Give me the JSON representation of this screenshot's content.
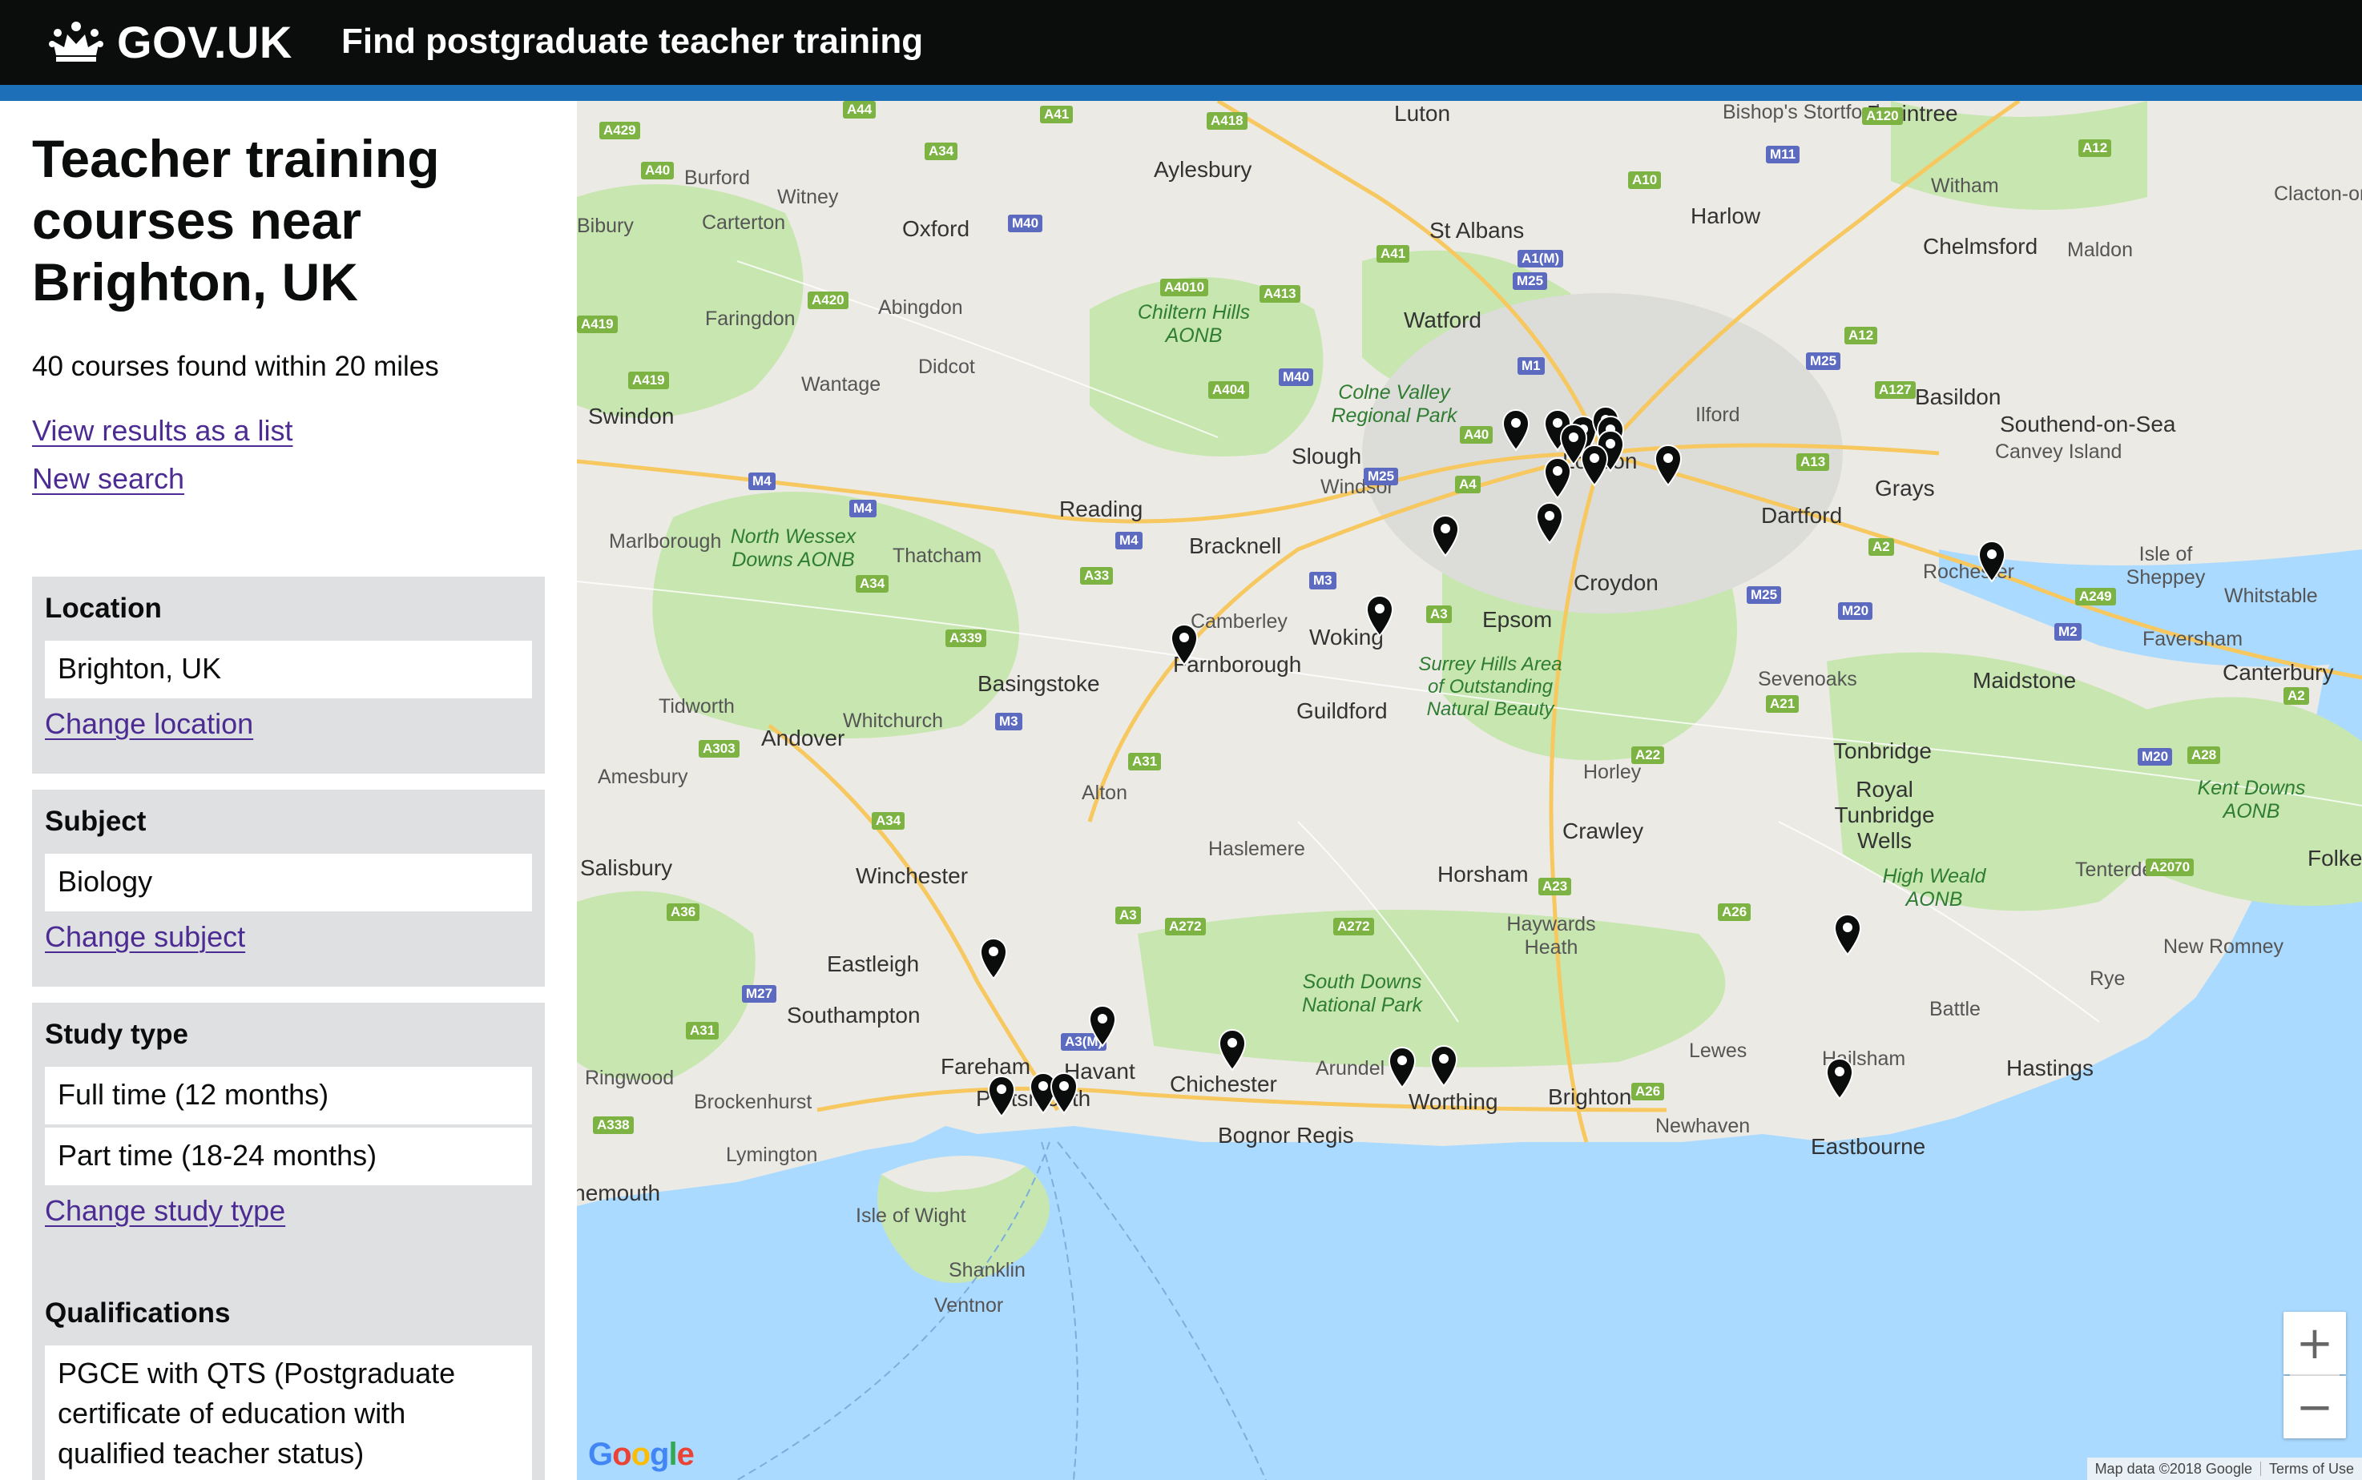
{
  "header": {
    "logo_text": "GOV.UK",
    "service_name": "Find postgraduate teacher training"
  },
  "sidebar": {
    "title": "Teacher training courses near Brighton, UK",
    "result_count": "40 courses found within 20 miles",
    "view_list_link": "View results as a list",
    "new_search_link": "New search",
    "location": {
      "heading": "Location",
      "value": "Brighton, UK",
      "change_link": "Change location"
    },
    "subject": {
      "heading": "Subject",
      "value": "Biology",
      "change_link": "Change subject"
    },
    "study_type": {
      "heading": "Study type",
      "values": [
        "Full time (12 months)",
        "Part time (18-24 months)"
      ],
      "change_link": "Change study type"
    },
    "qualifications": {
      "heading": "Qualifications",
      "value": "PGCE with QTS (Postgraduate certificate of education with qualified teacher status)"
    }
  },
  "map": {
    "places": [
      "Luton",
      "Aylesbury",
      "Bishop's Stortford",
      "Braintree",
      "Witham",
      "Burford",
      "Witney",
      "Carterton",
      "Oxford",
      "St Albans",
      "Harlow",
      "Chelmsford",
      "Maldon",
      "Bibury",
      "Faringdon",
      "Abingdon",
      "Chiltern Hills AONB",
      "Watford",
      "Didcot",
      "Wantage",
      "Swindon",
      "Colne Valley Regional Park",
      "Ilford",
      "Basildon",
      "Southend-on-Sea",
      "Canvey Island",
      "Slough",
      "Windsor",
      "London",
      "Grays",
      "Marlborough",
      "North Wessex Downs AONB",
      "Reading",
      "Thatcham",
      "Bracknell",
      "Dartford",
      "Isle of Sheppey",
      "Rochester",
      "Croydon",
      "Whitstable",
      "Camberley",
      "Farnborough",
      "Woking",
      "Epsom",
      "Faversham",
      "Basingstoke",
      "Surrey Hills Area of Outstanding Natural Beauty",
      "Sevenoaks",
      "Maidstone",
      "Canterbury",
      "Tidworth",
      "Andover",
      "Whitchurch",
      "Guildford",
      "Tonbridge",
      "Amesbury",
      "Alton",
      "Horley",
      "Royal Tunbridge Wells",
      "Kent Downs AONB",
      "Crawley",
      "Salisbury",
      "Winchester",
      "Haslemere",
      "Horsham",
      "High Weald AONB",
      "Tenterden",
      "Folkestone",
      "Haywards Heath",
      "Eastleigh",
      "New Romney",
      "Rye",
      "South Downs National Park",
      "Southampton",
      "Battle",
      "Ringwood",
      "Fareham",
      "Havant",
      "Chichester",
      "Arundel",
      "Lewes",
      "Hailsham",
      "Hastings",
      "Brockenhurst",
      "Portsmouth",
      "Worthing",
      "Brighton",
      "Newhaven",
      "Lymington",
      "Bognor Regis",
      "Eastbourne",
      "Bournemouth",
      "Isle of Wight",
      "Shanklin",
      "Ventnor",
      "Clacton-on-Sea"
    ],
    "zoom_in": "+",
    "zoom_out": "−",
    "google_logo": "Google",
    "attribution": "Map data ©2018 Google",
    "terms": "Terms of Use"
  }
}
